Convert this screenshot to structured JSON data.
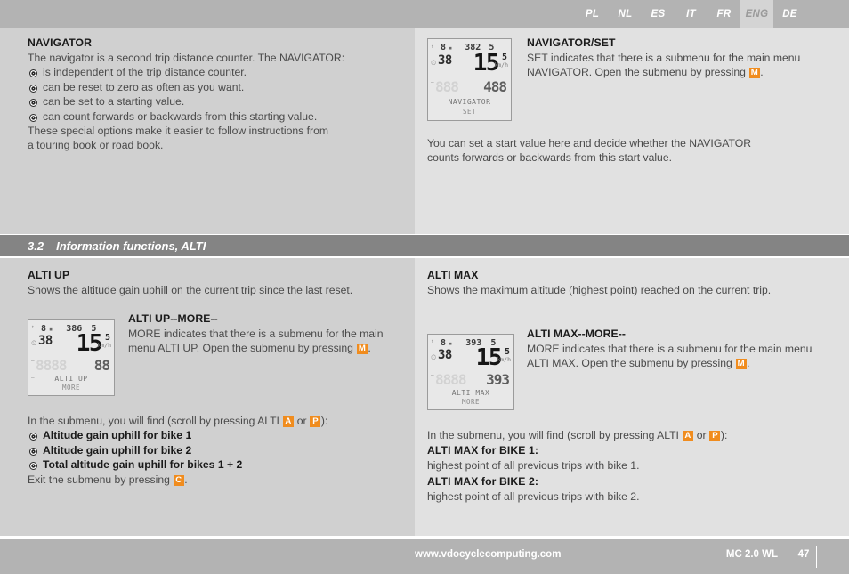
{
  "language_bar": {
    "tabs": [
      {
        "code": "PL",
        "active": false
      },
      {
        "code": "NL",
        "active": false
      },
      {
        "code": "ES",
        "active": false
      },
      {
        "code": "IT",
        "active": false
      },
      {
        "code": "FR",
        "active": false
      },
      {
        "code": "ENG",
        "active": true
      },
      {
        "code": "DE",
        "active": false
      }
    ]
  },
  "navigator": {
    "title": "NAVIGATOR",
    "intro": "The navigator is a second trip distance counter. The NAVIGATOR:",
    "bullets": [
      "is independent of the trip distance counter.",
      "can be reset to zero as often as you want.",
      "can be set to a starting value.",
      "can count forwards or backwards from this starting value."
    ],
    "outro_line1": "These special options make it easier to follow instructions from",
    "outro_line2": "a touring book or road book."
  },
  "navigator_set": {
    "title": "NAVIGATOR/SET",
    "body_pre": "SET indicates that there is a submenu for the main menu NAVIGATOR. Open the submenu by pressing ",
    "key": "M",
    "body_post": ".",
    "note_line1": "You can set a start value here and decide whether the NAVIGATOR",
    "note_line2": "counts forwards or backwards from this start value."
  },
  "lcd_navigator": {
    "top_left_glyph": "↑",
    "top_value": "8",
    "top_dot": "▪",
    "altitude": "382",
    "unit_sup": "5",
    "clock_icon": "⌚",
    "clock": "38",
    "speed": "15",
    "speed_decimal": "5",
    "speed_unit": "km/h",
    "sub_value": "488",
    "ghost_value": "888",
    "label": "NAVIGATOR",
    "label2": "SET"
  },
  "section": {
    "number": "3.2",
    "title": "Information functions, ALTI"
  },
  "alti_up": {
    "title": "ALTI UP",
    "body": "Shows the altitude gain uphill on the current trip since the last reset."
  },
  "lcd_alti_up": {
    "top_left_glyph": "↑",
    "top_value": "8",
    "top_dot": "▪",
    "altitude": "386",
    "unit_sup": "5",
    "clock": "38",
    "speed": "15",
    "speed_decimal": "5",
    "speed_unit": "km/h",
    "sub_value": "88",
    "ghost_value": "8888",
    "label": "ALTI UP",
    "label2": "MORE"
  },
  "alti_up_more": {
    "title": "ALTI UP--MORE--",
    "body_pre": "MORE indicates that there is a submenu for the main menu ALTI UP. Open the submenu by pressing ",
    "key": "M",
    "body_post": "."
  },
  "alti_up_submenu": {
    "intro_pre": "In the submenu, you will find (scroll by pressing ALTI ",
    "key_a": "A",
    "intro_mid": " or ",
    "key_p": "P",
    "intro_post": "):",
    "items": [
      "Altitude gain uphill for bike 1",
      "Altitude gain uphill for bike 2",
      "Total altitude gain uphill for bikes 1 + 2"
    ],
    "exit_pre": "Exit the submenu by pressing ",
    "key_c": "C",
    "exit_post": "."
  },
  "alti_max": {
    "title": "ALTI MAX",
    "body": "Shows the maximum altitude (highest point) reached on the current trip."
  },
  "lcd_alti_max": {
    "top_left_glyph": "↑",
    "top_value": "8",
    "top_dot": "▪",
    "altitude": "393",
    "unit_sup": "5",
    "clock": "38",
    "speed": "15",
    "speed_decimal": "5",
    "speed_unit": "km/h",
    "sub_value": "393",
    "ghost_value": "8888",
    "label": "ALTI MAX",
    "label2": "MORE"
  },
  "alti_max_more": {
    "title": "ALTI MAX--MORE--",
    "body_pre": "MORE indicates that there is a submenu for the main menu ALTI MAX. Open the submenu by pressing ",
    "key": "M",
    "body_post": "."
  },
  "alti_max_submenu": {
    "intro_pre": "In the submenu, you will find (scroll by pressing ALTI ",
    "key_a": "A",
    "intro_mid": " or ",
    "key_p": "P",
    "intro_post": "):",
    "bike1_title": "ALTI MAX for BIKE 1:",
    "bike1_body": "highest point of all previous trips with bike 1.",
    "bike2_title": "ALTI MAX for BIKE 2:",
    "bike2_body": "highest point of all previous trips with bike 2."
  },
  "footer": {
    "url": "www.vdocyclecomputing.com",
    "model": "MC 2.0 WL",
    "page": "47"
  },
  "colors": {
    "accent_orange": "#f08c1e",
    "band_gray": "#848484",
    "bar_gray": "#b3b3b3",
    "col_left": "#d0d0d0",
    "col_right": "#e1e1e1"
  }
}
